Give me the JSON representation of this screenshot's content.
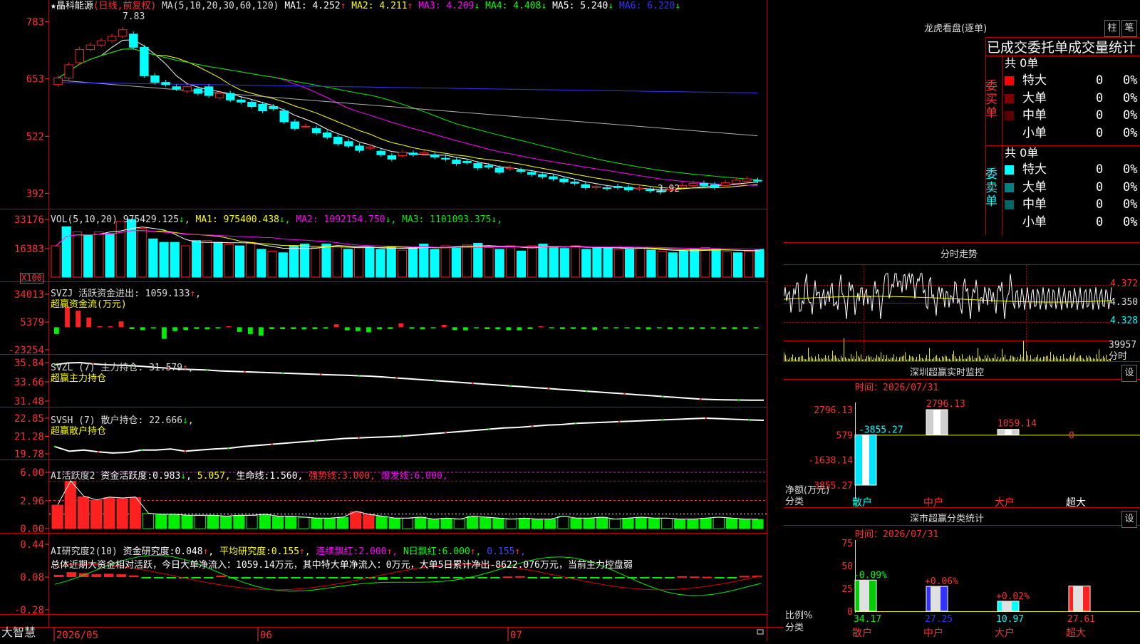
{
  "app": {
    "brand": "大智慧"
  },
  "header": {
    "stock": "★晶科能源",
    "period": "(日线,前复权)",
    "ma_def": "MA(5,10,20,30,60,120)",
    "items": [
      {
        "text": "MA1:",
        "val": "4.252",
        "arr": "↑",
        "color": "#ffffff"
      },
      {
        "text": "MA2:",
        "val": "4.211",
        "arr": "↑",
        "color": "#ffff00"
      },
      {
        "text": "MA3:",
        "val": "4.209",
        "arr": "↓",
        "color": "#ff00ff"
      },
      {
        "text": "MA4:",
        "val": "4.408",
        "arr": "↓",
        "color": "#00ff00"
      },
      {
        "text": "MA5:",
        "val": "5.240",
        "arr": "↓",
        "color": "#ffffff"
      },
      {
        "text": "MA6:",
        "val": "6.220",
        "arr": "↓",
        "color": "#3333ff"
      }
    ],
    "hi_label": "7.83",
    "lo_label": "←3.92"
  },
  "colors": {
    "up": "#ff2020",
    "down": "#00ffff",
    "axis": "#ff3030",
    "green": "#00ee00",
    "white": "#ffffff",
    "yellow": "#ffff00",
    "magenta": "#ff00ff",
    "blue": "#3333ff",
    "gray": "#b0b0b0"
  },
  "panels": {
    "vol": {
      "title": "VOL(5,10,20)",
      "val": "975429.125",
      "items": [
        {
          "text": "MA1:",
          "val": "975400.438"
        },
        {
          "text": "MA2:",
          "val": "1092154.750"
        },
        {
          "text": "MA3:",
          "val": "1101093.375"
        }
      ],
      "unit": "X100"
    },
    "svzj": {
      "title": "SVZJ",
      "label": "活跃资金进出:",
      "val": "1059.133",
      "sub": "超赢资金流(万元)"
    },
    "svzl": {
      "title": "SVZL (7)",
      "label": "主力持仓:",
      "val": "31.579",
      "sub": "超赢主力持仓"
    },
    "svsh": {
      "title": "SVSH (7)",
      "label": "散户持仓:",
      "val": "22.666",
      "sub": "超赢散户持仓"
    },
    "ai1": {
      "title": "AI活跃度2",
      "items": [
        {
          "text": "资金活跃度:",
          "val": "0.983",
          "arr": "↓"
        },
        {
          "text": "",
          "val": "5.057",
          "arr": ""
        },
        {
          "text": "生命线:",
          "val": "1.560",
          "arr": ""
        },
        {
          "text": "强势线:",
          "val": "3.000",
          "arr": ""
        },
        {
          "text": "爆发线:",
          "val": "6.000",
          "arr": ""
        }
      ]
    },
    "ai2": {
      "title": "AI研究度2(10)",
      "items": [
        {
          "text": "资金研究度:",
          "val": "0.048",
          "arr": "↑"
        },
        {
          "text": "平均研究度:",
          "val": "0.155",
          "arr": "↑"
        },
        {
          "text": "连续飘红:",
          "val": "2.000",
          "arr": "↑"
        },
        {
          "text": "N日飘红:",
          "val": "6.000",
          "arr": "↑"
        },
        {
          "text": "",
          "val": "0.155",
          "arr": "↑"
        }
      ],
      "note": "总体近期大资金相对活跃，今日大单净流入：1059.14万元，其中特大单净流入：0万元，大单5日累计净出-8622.076万元，当前主力控盘弱"
    }
  },
  "axes": {
    "price": [
      "783",
      "653",
      "522",
      "392"
    ],
    "vol": [
      "33176",
      "16383"
    ],
    "svzj": [
      "34013",
      "5379",
      "-23254"
    ],
    "svzl": [
      "35.84",
      "33.66",
      "31.48"
    ],
    "svsh": [
      "22.85",
      "21.28",
      "19.78"
    ],
    "ai1": [
      "6.00",
      "2.96",
      "0.00"
    ],
    "ai2": [
      "0.44",
      "0.08",
      "-0.28"
    ],
    "dates": [
      "2026/05",
      "06",
      "07"
    ]
  },
  "chart_data": [
    {
      "type": "candlestick",
      "title": "★晶科能源",
      "subtitle": "(日线,前复权)",
      "ylim": [
        3.7,
        8.1
      ],
      "open": [
        6.4,
        6.55,
        6.9,
        7.2,
        7.3,
        7.4,
        7.5,
        7.55,
        7.25,
        6.6,
        6.45,
        6.35,
        6.25,
        6.3,
        6.35,
        6.1,
        6.2,
        6.05,
        6.0,
        5.95,
        5.9,
        5.8,
        5.55,
        5.45,
        5.4,
        5.3,
        5.2,
        5.1,
        5.0,
        4.95,
        4.88,
        4.78,
        4.78,
        4.84,
        4.82,
        4.8,
        4.72,
        4.68,
        4.65,
        4.6,
        4.55,
        4.5,
        4.48,
        4.45,
        4.4,
        4.35,
        4.3,
        4.25,
        4.18,
        4.12,
        4.05,
        4.05,
        4.08,
        4.06,
        4.02,
        4.0,
        3.98,
        4.0,
        4.05,
        4.1,
        4.15,
        4.12,
        4.1,
        4.15,
        4.2,
        4.22
      ],
      "close": [
        6.55,
        6.85,
        7.2,
        7.3,
        7.4,
        7.5,
        7.65,
        7.25,
        6.6,
        6.45,
        6.4,
        6.3,
        6.35,
        6.2,
        6.15,
        6.2,
        6.05,
        6.0,
        5.9,
        5.8,
        5.85,
        5.55,
        5.4,
        5.45,
        5.3,
        5.2,
        5.05,
        5.0,
        4.9,
        4.98,
        4.8,
        4.7,
        4.86,
        4.8,
        4.85,
        4.75,
        4.7,
        4.6,
        4.62,
        4.5,
        4.52,
        4.4,
        4.5,
        4.42,
        4.35,
        4.3,
        4.25,
        4.18,
        4.15,
        4.05,
        4.08,
        4.03,
        4.05,
        4.0,
        4.04,
        3.98,
        3.95,
        4.05,
        4.1,
        4.15,
        4.1,
        4.05,
        4.16,
        4.22,
        4.25,
        4.2
      ]
    },
    {
      "type": "bar",
      "title": "VOL(5,10,20)",
      "values": [
        18000,
        29000,
        26000,
        24000,
        26000,
        25000,
        32000,
        33176,
        28000,
        22000,
        20000,
        20000,
        18000,
        21000,
        21000,
        20000,
        19000,
        18000,
        20000,
        16000,
        15000,
        14000,
        18000,
        19000,
        17000,
        19000,
        18000,
        16000,
        17000,
        17000,
        16000,
        17500,
        15500,
        17000,
        19000,
        16000,
        18000,
        17500,
        18500,
        19500,
        17000,
        16000,
        18000,
        15000,
        18000,
        19000,
        17500,
        16500,
        18000,
        16000,
        17000,
        17000,
        16000,
        16000,
        17000,
        15500,
        15000,
        14000,
        15000,
        16000,
        17000,
        16000,
        14500,
        14000,
        15000,
        16000
      ]
    },
    {
      "type": "bar",
      "title": "SVZJ",
      "values": [
        -7000,
        21000,
        17000,
        10000,
        1000,
        1000,
        6000,
        -2000,
        -3000,
        -1200,
        -12000,
        -4000,
        -2800,
        -1800,
        -2200,
        -1200,
        1000,
        -4800,
        -7000,
        -8600,
        -2000,
        -2000,
        -2000,
        -2200,
        -2000,
        -1500,
        3000,
        -3200,
        -4000,
        -5200,
        -2200,
        -1800,
        4000,
        -1500,
        -2200,
        -800,
        2500,
        -2800,
        -3200,
        -1000,
        -2000,
        -2200,
        -3000,
        -3200,
        -2000,
        1000,
        -500,
        -2000,
        -1800,
        -2100,
        -2600,
        -1500,
        -1000,
        -800,
        -1800,
        -2300,
        -800,
        -2100,
        -1600,
        -2000,
        -1800,
        -1400,
        -1900,
        -2100,
        -1700,
        -1200
      ]
    },
    {
      "type": "line",
      "title": "SVZL (7)",
      "values": [
        35.6,
        35.8,
        35.84,
        35.7,
        35.6,
        35.55,
        35.5,
        35.4,
        35.3,
        35.2,
        35.1,
        35.05,
        35.0,
        34.9,
        34.85,
        34.8,
        34.75,
        34.7,
        34.65,
        34.6,
        34.55,
        34.5,
        34.45,
        34.4,
        34.35,
        34.3,
        34.2,
        34.1,
        34.0,
        33.9,
        33.8,
        33.7,
        33.6,
        33.5,
        33.4,
        33.3,
        33.2,
        33.1,
        33.0,
        32.9,
        32.8,
        32.7,
        32.6,
        32.5,
        32.4,
        32.3,
        32.2,
        32.1,
        32.0,
        31.9,
        31.8,
        31.7,
        31.65,
        31.62,
        31.6,
        31.58,
        31.579
      ]
    },
    {
      "type": "line",
      "title": "SVSH (7)",
      "values": [
        20.4,
        20.0,
        20.1,
        19.95,
        19.85,
        19.9,
        20.1,
        20.1,
        20.2,
        20.0,
        20.1,
        20.2,
        20.25,
        20.4,
        20.5,
        20.6,
        20.7,
        20.8,
        20.9,
        21.0,
        21.1,
        21.15,
        21.2,
        21.25,
        21.3,
        21.4,
        21.5,
        21.6,
        21.7,
        21.8,
        21.9,
        22.0,
        22.05,
        22.15,
        22.25,
        22.3,
        22.4,
        22.45,
        22.5,
        22.55,
        22.6,
        22.65,
        22.7,
        22.75,
        22.8,
        22.85,
        22.8,
        22.75,
        22.7,
        22.666
      ]
    },
    {
      "type": "bar",
      "title": "AI活跃度2",
      "values": [
        2.5,
        5.057,
        3.4,
        3.0,
        3.3,
        3.2,
        3.3,
        1.6,
        1.5,
        1.5,
        1.4,
        1.4,
        1.4,
        1.3,
        1.4,
        1.4,
        1.5,
        1.3,
        1.3,
        1.2,
        1.1,
        1.1,
        1.2,
        1.8,
        1.5,
        1.3,
        1.1,
        1.1,
        1.2,
        1.0,
        1.1,
        1.0,
        1.3,
        1.2,
        1.1,
        1.0,
        1.1,
        1.0,
        1.0,
        1.3,
        1.1,
        1.1,
        1.2,
        1.0,
        1.1,
        1.2,
        1.1,
        1.1,
        1.0,
        1.0,
        1.1,
        1.2,
        1.1,
        1.0,
        0.983
      ],
      "lines": {
        "强势线": 3.0,
        "爆发线": 6.0,
        "生命线": 1.56
      }
    },
    {
      "type": "bar",
      "title": "AI研究度2(10)",
      "values": [
        0.08,
        0.18,
        0.14,
        0.1,
        0.12,
        0.1,
        0.06,
        -0.02,
        -0.04,
        -0.05,
        -0.05,
        -0.03,
        -0.02,
        0.05,
        -0.04,
        -0.06,
        -0.03,
        -0.05,
        -0.05,
        -0.03,
        -0.04,
        -0.03,
        -0.05,
        -0.02,
        -0.06,
        -0.05,
        -0.1,
        -0.06,
        -0.04,
        -0.03,
        -0.02,
        -0.03,
        -0.05,
        -0.04,
        -0.04,
        -0.03,
        0.02,
        0.03,
        -0.03,
        -0.02,
        -0.04,
        -0.05,
        -0.03,
        -0.04,
        -0.06,
        -0.05,
        -0.04,
        -0.03,
        -0.03,
        -0.02,
        0.03,
        0.02,
        0.01,
        -0.02,
        -0.03,
        0.04,
        0.048
      ]
    }
  ],
  "side": {
    "longhu": {
      "title": "龙虎看盘(逐单)",
      "btn1": "柱",
      "btn2": "笔",
      "sub": "已成交委托单成交量统计",
      "buy": {
        "side": "委买单",
        "total": "共 0单",
        "rows": [
          {
            "name": "特大",
            "val": "0",
            "pct": "0%",
            "color": "#ff0000"
          },
          {
            "name": "大单",
            "val": "0",
            "pct": "0%",
            "color": "#800000"
          },
          {
            "name": "中单",
            "val": "0",
            "pct": "0%",
            "color": "#5a0000"
          },
          {
            "name": "小单",
            "val": "0",
            "pct": "0%",
            "color": ""
          }
        ]
      },
      "sell": {
        "side": "委卖单",
        "total": "共 0单",
        "rows": [
          {
            "name": "特大",
            "val": "0",
            "pct": "0%",
            "color": "#00ffff"
          },
          {
            "name": "大单",
            "val": "0",
            "pct": "0%",
            "color": "#008080"
          },
          {
            "name": "中单",
            "val": "0",
            "pct": "0%",
            "color": "#006666"
          },
          {
            "name": "小单",
            "val": "0",
            "pct": "0%",
            "color": ""
          }
        ]
      }
    },
    "fenshi": {
      "title": "分时走势",
      "p1": "4.372",
      "p2": "4.350",
      "p3": "4.328",
      "vmax": "39957",
      "vunit": "分时"
    },
    "monitor": {
      "title": "深圳超赢实时监控",
      "btn": "设",
      "time": "时间：2026/07/31",
      "ylabels": [
        "2796.13",
        "579",
        "-1638.14",
        "-3855.27"
      ],
      "cats": [
        "散户",
        "中户",
        "大户",
        "超大"
      ],
      "values": [
        -3855.27,
        2796.13,
        1059.14,
        0
      ],
      "labels": [
        "-3855.27",
        "2796.13",
        "1059.14",
        "0"
      ],
      "axis_label1": "净额(万元)",
      "axis_label2": "分类"
    },
    "fenlei": {
      "title": "深市超赢分类统计",
      "btn": "设",
      "time": "时间：2026/07/31",
      "ylabels": [
        "75",
        "50",
        "25",
        "0"
      ],
      "cats": [
        "散户",
        "中户",
        "大户",
        "超大"
      ],
      "values": [
        34.17,
        27.25,
        10.97,
        27.61
      ],
      "labels": [
        "34.17",
        "27.25",
        "10.97",
        "27.61"
      ],
      "deltas": [
        "-0.09%",
        "+0.06%",
        "+0.02%",
        ""
      ],
      "axis_label1": "比例%",
      "axis_label2": "分类"
    }
  }
}
